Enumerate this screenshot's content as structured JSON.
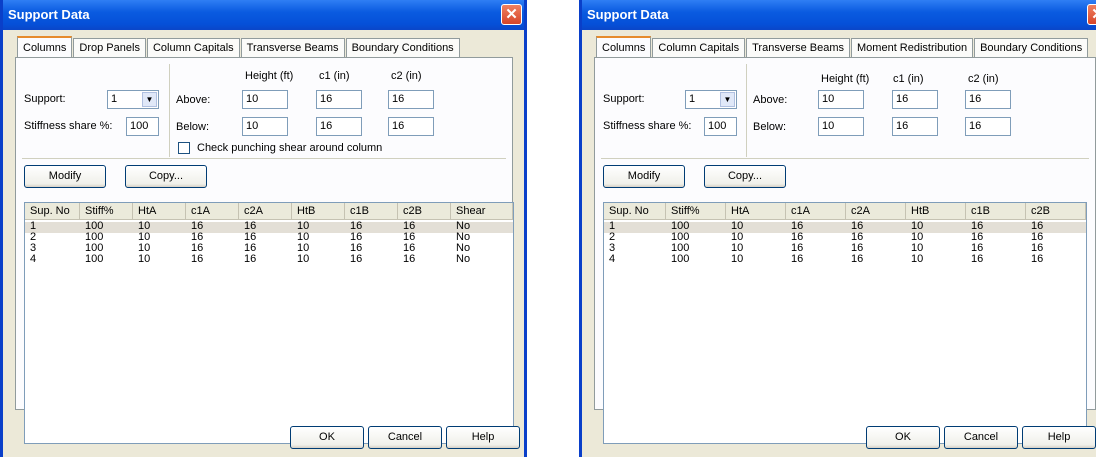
{
  "dialogs": [
    {
      "title": "Support Data",
      "tabs": [
        "Columns",
        "Drop Panels",
        "Column Capitals",
        "Transverse Beams",
        "Boundary Conditions"
      ],
      "support_label": "Support:",
      "support_value": "1",
      "stiffness_label": "Stiffness share %:",
      "stiffness_value": "100",
      "height_header": "Height (ft)",
      "c1_header": "c1 (in)",
      "c2_header": "c2 (in)",
      "above_label": "Above:",
      "below_label": "Below:",
      "above": [
        "10",
        "16",
        "16"
      ],
      "below": [
        "10",
        "16",
        "16"
      ],
      "checkbox_label": "Check punching shear around column",
      "modify_label": "Modify",
      "copy_label": "Copy...",
      "columns": [
        "Sup. No",
        "Stiff%",
        "HtA",
        "c1A",
        "c2A",
        "HtB",
        "c1B",
        "c2B",
        "Shear"
      ],
      "rows": [
        [
          "1",
          "100",
          "10",
          "16",
          "16",
          "10",
          "16",
          "16",
          "No"
        ],
        [
          "2",
          "100",
          "10",
          "16",
          "16",
          "10",
          "16",
          "16",
          "No"
        ],
        [
          "3",
          "100",
          "10",
          "16",
          "16",
          "10",
          "16",
          "16",
          "No"
        ],
        [
          "4",
          "100",
          "10",
          "16",
          "16",
          "10",
          "16",
          "16",
          "No"
        ]
      ],
      "ok_label": "OK",
      "cancel_label": "Cancel",
      "help_label": "Help"
    },
    {
      "title": "Support Data",
      "tabs": [
        "Columns",
        "Column Capitals",
        "Transverse Beams",
        "Moment Redistribution",
        "Boundary Conditions"
      ],
      "support_label": "Support:",
      "support_value": "1",
      "stiffness_label": "Stiffness share %:",
      "stiffness_value": "100",
      "height_header": "Height (ft)",
      "c1_header": "c1 (in)",
      "c2_header": "c2 (in)",
      "above_label": "Above:",
      "below_label": "Below:",
      "above": [
        "10",
        "16",
        "16"
      ],
      "below": [
        "10",
        "16",
        "16"
      ],
      "modify_label": "Modify",
      "copy_label": "Copy...",
      "columns": [
        "Sup. No",
        "Stiff%",
        "HtA",
        "c1A",
        "c2A",
        "HtB",
        "c1B",
        "c2B"
      ],
      "rows": [
        [
          "1",
          "100",
          "10",
          "16",
          "16",
          "10",
          "16",
          "16"
        ],
        [
          "2",
          "100",
          "10",
          "16",
          "16",
          "10",
          "16",
          "16"
        ],
        [
          "3",
          "100",
          "10",
          "16",
          "16",
          "10",
          "16",
          "16"
        ],
        [
          "4",
          "100",
          "10",
          "16",
          "16",
          "10",
          "16",
          "16"
        ]
      ],
      "ok_label": "OK",
      "cancel_label": "Cancel",
      "help_label": "Help"
    }
  ]
}
